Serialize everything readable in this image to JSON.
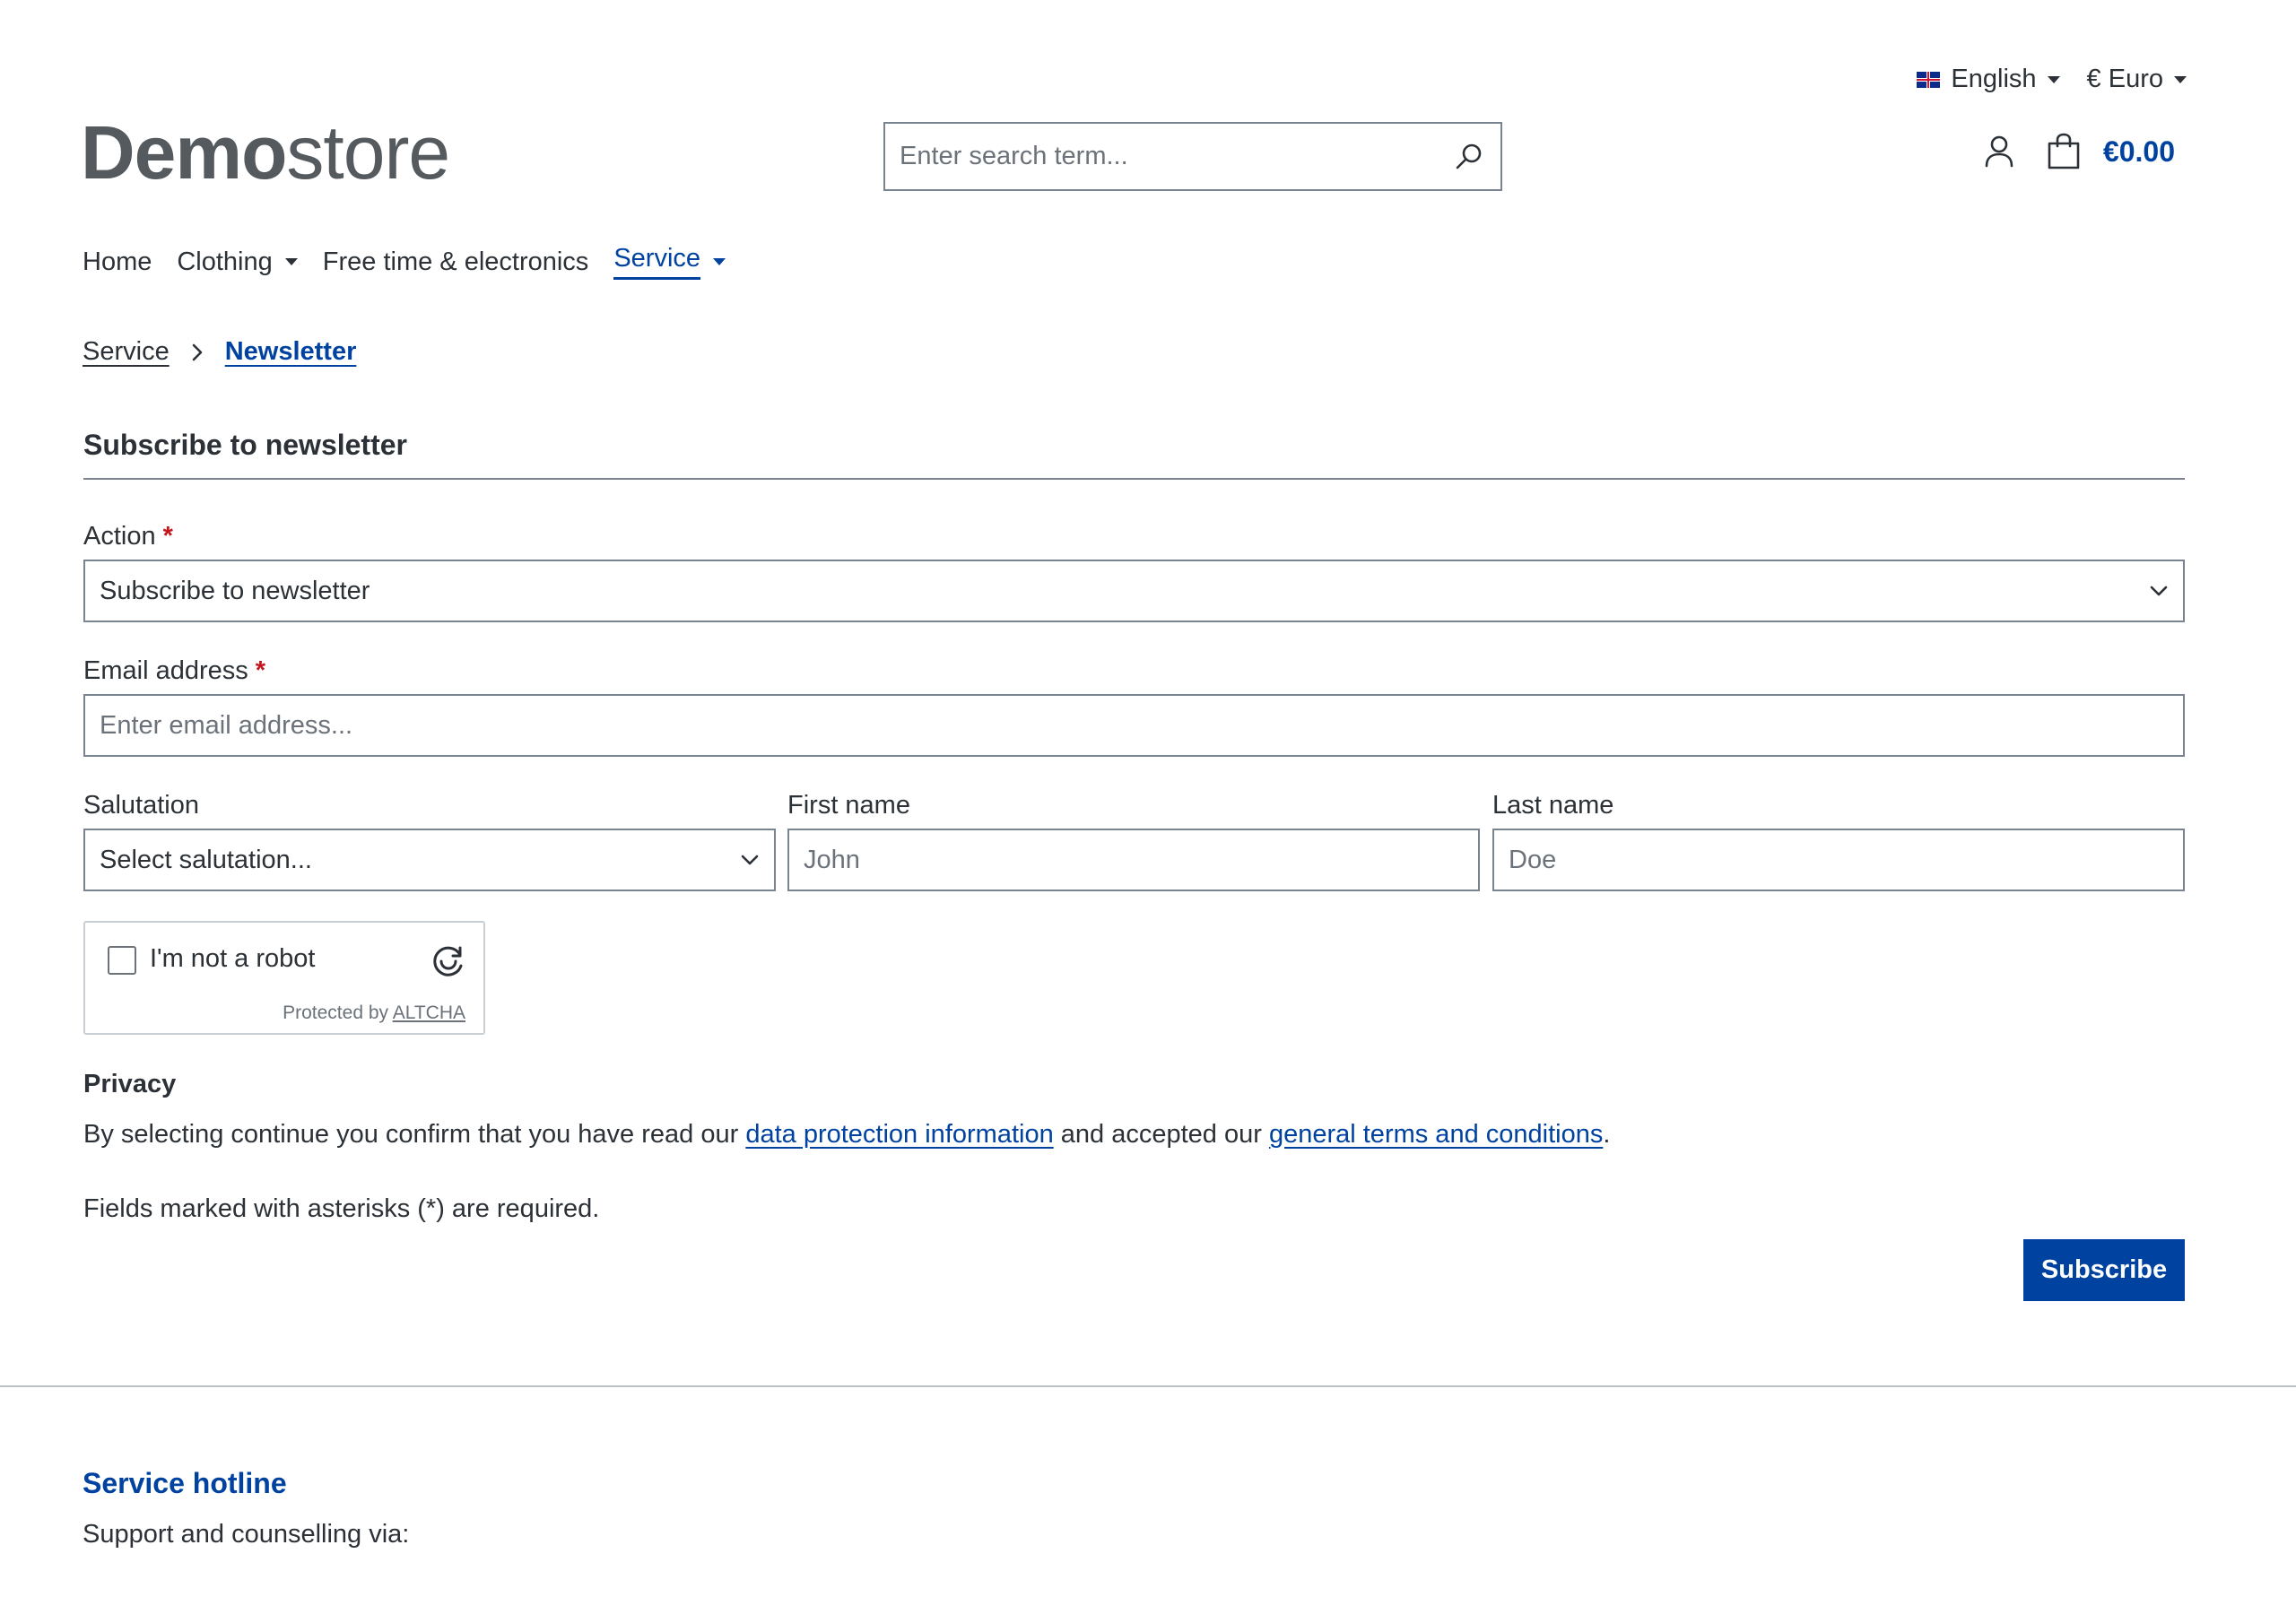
{
  "topbar": {
    "language": "English",
    "currency": "€ Euro"
  },
  "logo": {
    "bold": "Demo",
    "light": "store"
  },
  "search": {
    "placeholder": "Enter search term..."
  },
  "header": {
    "cart_total": "€0.00"
  },
  "nav": {
    "items": [
      {
        "label": "Home",
        "dropdown": false,
        "active": false
      },
      {
        "label": "Clothing",
        "dropdown": true,
        "active": false
      },
      {
        "label": "Free time & electronics",
        "dropdown": false,
        "active": false
      },
      {
        "label": "Service",
        "dropdown": true,
        "active": true
      }
    ]
  },
  "breadcrumb": {
    "items": [
      "Service",
      "Newsletter"
    ]
  },
  "form": {
    "title": "Subscribe to newsletter",
    "action_label": "Action",
    "action_value": "Subscribe to newsletter",
    "email_label": "Email address",
    "email_placeholder": "Enter email address...",
    "salutation_label": "Salutation",
    "salutation_value": "Select salutation...",
    "first_name_label": "First name",
    "first_name_placeholder": "John",
    "last_name_label": "Last name",
    "last_name_placeholder": "Doe",
    "required_marker": "*",
    "captcha": {
      "label": "I'm not a robot",
      "protected_by": "Protected by",
      "provider": "ALTCHA"
    },
    "privacy": {
      "title": "Privacy",
      "text_before": "By selecting continue you confirm that you have read our",
      "link1": "data protection information",
      "text_middle": "and accepted our",
      "link2": "general terms and conditions",
      "text_after": "."
    },
    "required_note": "Fields marked with asterisks (*) are required.",
    "submit_label": "Subscribe"
  },
  "footer": {
    "hotline_title": "Service hotline",
    "hotline_text": "Support and counselling via:"
  },
  "colors": {
    "accent": "#0042a0",
    "text": "#2b3136",
    "required": "#c3161c",
    "border": "#798490"
  },
  "icons": {
    "search": "search-icon",
    "account": "user-icon",
    "cart": "shopping-bag-icon",
    "chevron": "chevron-down-icon",
    "captcha": "altcha-logo-icon"
  }
}
